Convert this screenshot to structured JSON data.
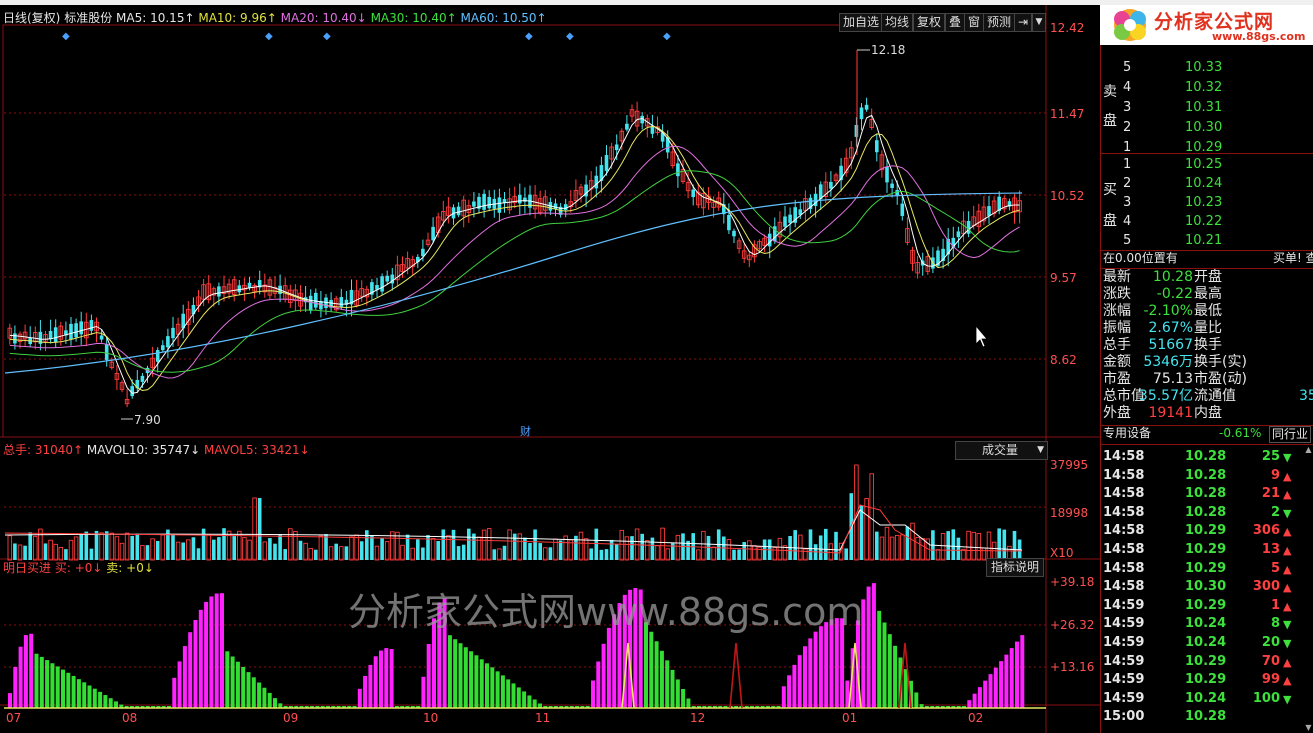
{
  "chart_header": {
    "title": "日线(复权)",
    "stock_name": "标准股份",
    "ma5": "MA5: 10.15↑",
    "ma10": "MA10: 9.96↑",
    "ma20": "MA20: 10.40↓",
    "ma30": "MA30: 10.40↑",
    "ma60": "MA60: 10.50↑"
  },
  "toolbar": {
    "add_watch": "加自选",
    "avg_line": "均线",
    "restore": "复权",
    "overlay": "叠",
    "window": "窗",
    "forecast": "预测"
  },
  "price_axis": [
    "12.42",
    "11.47",
    "10.52",
    "9.57",
    "8.62"
  ],
  "annotations": {
    "high": "12.18",
    "low": "7.90",
    "finance_marker": "财"
  },
  "volume_header": {
    "total": "总手: 31040↑",
    "mavol10": "MAVOL10: 35747↓",
    "mavol5": "MAVOL5: 33421↓",
    "selector": "成交量"
  },
  "volume_axis": [
    "37995",
    "18998",
    "X10"
  ],
  "indicator_header": {
    "name": "明日买进",
    "buy": "买: +0↓",
    "sell": "卖: +0↓",
    "explain": "指标说明"
  },
  "indicator_axis": [
    "+39.18",
    "+26.32",
    "+13.16"
  ],
  "date_axis": [
    "07",
    "08",
    "09",
    "10",
    "11",
    "12",
    "01",
    "02"
  ],
  "watermark": "分析家公式网www.88gs.com",
  "logo": {
    "text": "分析家公式网",
    "url": "www.88gs.com"
  },
  "order_book": {
    "sell_label": [
      "卖",
      "盘"
    ],
    "buy_label": [
      "买",
      "盘"
    ],
    "sell": [
      {
        "level": "5",
        "price": "10.33"
      },
      {
        "level": "4",
        "price": "10.32"
      },
      {
        "level": "3",
        "price": "10.31"
      },
      {
        "level": "2",
        "price": "10.30"
      },
      {
        "level": "1",
        "price": "10.29"
      }
    ],
    "buy": [
      {
        "level": "1",
        "price": "10.25"
      },
      {
        "level": "2",
        "price": "10.24"
      },
      {
        "level": "3",
        "price": "10.23"
      },
      {
        "level": "4",
        "price": "10.22"
      },
      {
        "level": "5",
        "price": "10.21"
      }
    ],
    "position_text": "在0.00位置有",
    "buy_tip": "买单! 查"
  },
  "quote": [
    {
      "k1": "最新",
      "v1": "10.28",
      "k2": "开盘",
      "v2": ""
    },
    {
      "k1": "涨跌",
      "v1": "-0.22",
      "k2": "最高",
      "v2": ""
    },
    {
      "k1": "涨幅",
      "v1": "-2.10%",
      "k2": "最低",
      "v2": ""
    },
    {
      "k1": "振幅",
      "v1": "2.67%",
      "k2": "量比",
      "v2": ""
    },
    {
      "k1": "总手",
      "v1": "51667",
      "k2": "换手",
      "v2": ""
    },
    {
      "k1": "金额",
      "v1": "5346万",
      "k2": "换手(实)",
      "v2": ""
    },
    {
      "k1": "市盈",
      "v1": "75.13",
      "k2": "市盈(动)",
      "v2": ""
    },
    {
      "k1": "总市值",
      "v1": "35.57亿",
      "k2": "流通值",
      "v2": "35"
    },
    {
      "k1": "外盘",
      "v1": "19141",
      "k2": "内盘",
      "v2": ""
    }
  ],
  "sector": {
    "name": "专用设备",
    "change": "-0.61%",
    "peer": "同行业"
  },
  "ticks": [
    {
      "time": "14:58",
      "price": "10.28",
      "vol": "25",
      "dir": "down"
    },
    {
      "time": "14:58",
      "price": "10.28",
      "vol": "9",
      "dir": "up"
    },
    {
      "time": "14:58",
      "price": "10.28",
      "vol": "21",
      "dir": "up"
    },
    {
      "time": "14:58",
      "price": "10.28",
      "vol": "2",
      "dir": "down"
    },
    {
      "time": "14:58",
      "price": "10.29",
      "vol": "306",
      "dir": "up"
    },
    {
      "time": "14:58",
      "price": "10.29",
      "vol": "13",
      "dir": "up"
    },
    {
      "time": "14:58",
      "price": "10.29",
      "vol": "5",
      "dir": "up"
    },
    {
      "time": "14:58",
      "price": "10.30",
      "vol": "300",
      "dir": "up"
    },
    {
      "time": "14:59",
      "price": "10.29",
      "vol": "1",
      "dir": "up"
    },
    {
      "time": "14:59",
      "price": "10.24",
      "vol": "8",
      "dir": "down"
    },
    {
      "time": "14:59",
      "price": "10.24",
      "vol": "20",
      "dir": "down"
    },
    {
      "time": "14:59",
      "price": "10.29",
      "vol": "70",
      "dir": "up"
    },
    {
      "time": "14:59",
      "price": "10.29",
      "vol": "99",
      "dir": "up"
    },
    {
      "time": "14:59",
      "price": "10.24",
      "vol": "100",
      "dir": "down"
    },
    {
      "time": "15:00",
      "price": "10.28",
      "vol": "",
      "dir": ""
    }
  ],
  "colors": {
    "up": "#ff3c3c",
    "down": "#44e4ee",
    "ma5": "#ffffff",
    "ma10": "#e8e860",
    "ma20": "#e070e0",
    "ma30": "#40d040",
    "ma60": "#60c0ff",
    "buy_bar": "#ff22ff",
    "sell_bar": "#33dd33",
    "grid": "#8a1010"
  }
}
